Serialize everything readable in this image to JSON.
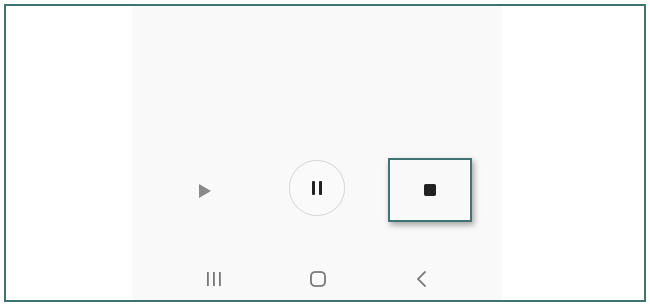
{
  "media_controls": {
    "play_icon": "play-icon",
    "pause_icon": "pause-icon",
    "stop_icon": "stop-icon",
    "highlighted": "stop"
  },
  "navigation_bar": {
    "recents_icon": "recents-icon",
    "home_icon": "home-icon",
    "back_icon": "back-icon"
  },
  "colors": {
    "frame_border": "#3f7471",
    "screen_background": "#f9f9f9",
    "icon_dark": "#222222",
    "icon_muted": "#8a8a8a",
    "nav_icon": "#777777"
  }
}
